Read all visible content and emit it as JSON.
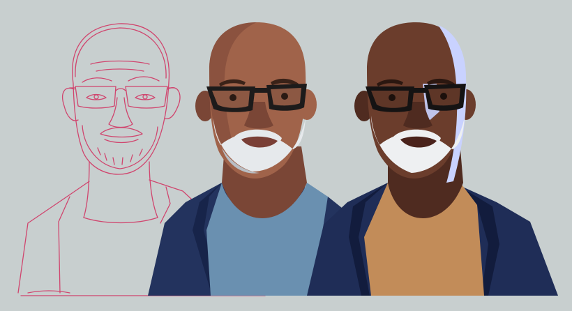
{
  "canvas": {
    "background": "#c8cfcf"
  },
  "sketch": {
    "stroke_color": "#d0456e"
  },
  "portrait_flat": {
    "skin": "#a0634a",
    "skin_shadow": "#7a4636",
    "beard": "#e6e9ec",
    "jacket": "#23335e",
    "shirt": "#6a90b0",
    "glasses": "#1d1b1b"
  },
  "portrait_shaded": {
    "skin": "#6b3d2c",
    "skin_shadow": "#4f2b20",
    "rim_light": "#c9d2ff",
    "beard": "#eef0f2",
    "jacket": "#1f2d57",
    "shirt": "#c28c59",
    "glasses": "#151313"
  }
}
